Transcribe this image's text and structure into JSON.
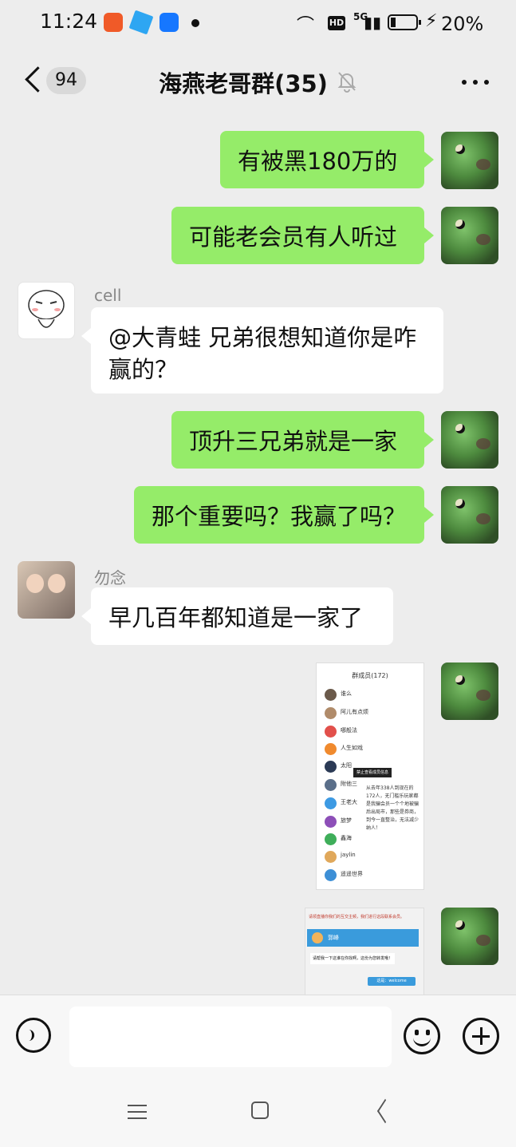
{
  "status_bar": {
    "time": "11:24",
    "network": "5G",
    "hd": "HD",
    "battery_percent": "20%",
    "battery_level": 0.2
  },
  "header": {
    "back_count": "94",
    "title": "海燕老哥群(35)",
    "muted_icon": "bell-off-icon",
    "more_icon": "more-icon"
  },
  "messages": [
    {
      "side": "me",
      "text": "有被黑180万的"
    },
    {
      "side": "me",
      "text": "可能老会员有人听过"
    },
    {
      "side": "other",
      "sender": "cell",
      "text": "@大青蛙  兄弟很想知道你是咋赢的？"
    },
    {
      "side": "me",
      "text": "顶升三兄弟就是一家"
    },
    {
      "side": "me",
      "text": "那个重要吗？我赢了吗？"
    },
    {
      "side": "other",
      "sender": "勿念",
      "text": "早几百年都知道是一家了"
    }
  ],
  "image1": {
    "title": "群成员(172)",
    "rows": [
      "谁么",
      "阿儿有点烦",
      "哪般法",
      "人生如戏",
      "太阳",
      "附他三",
      "王老大",
      "旅梦",
      "鑫海",
      "jaylin",
      "遥遥世界"
    ],
    "popup": "禁止查看成员信息",
    "note": "从去年338人到现在的172人，无门槛乐玩家都是我骗会员一个个地被骗后出局市，那些是券商，到今一直整治，无法减少纳人！"
  },
  "image2": {
    "banner": "请领直播你我们的互交主频，我们进行这段联系会员。",
    "name": "郭峰",
    "msg": "请帮我一下这谁在你找啊，这份为您转发哦！",
    "reply": "这是：welcome"
  },
  "input": {
    "placeholder": ""
  },
  "colors": {
    "background": "#ededed",
    "my_bubble": "#95ec69",
    "other_bubble": "#ffffff"
  }
}
